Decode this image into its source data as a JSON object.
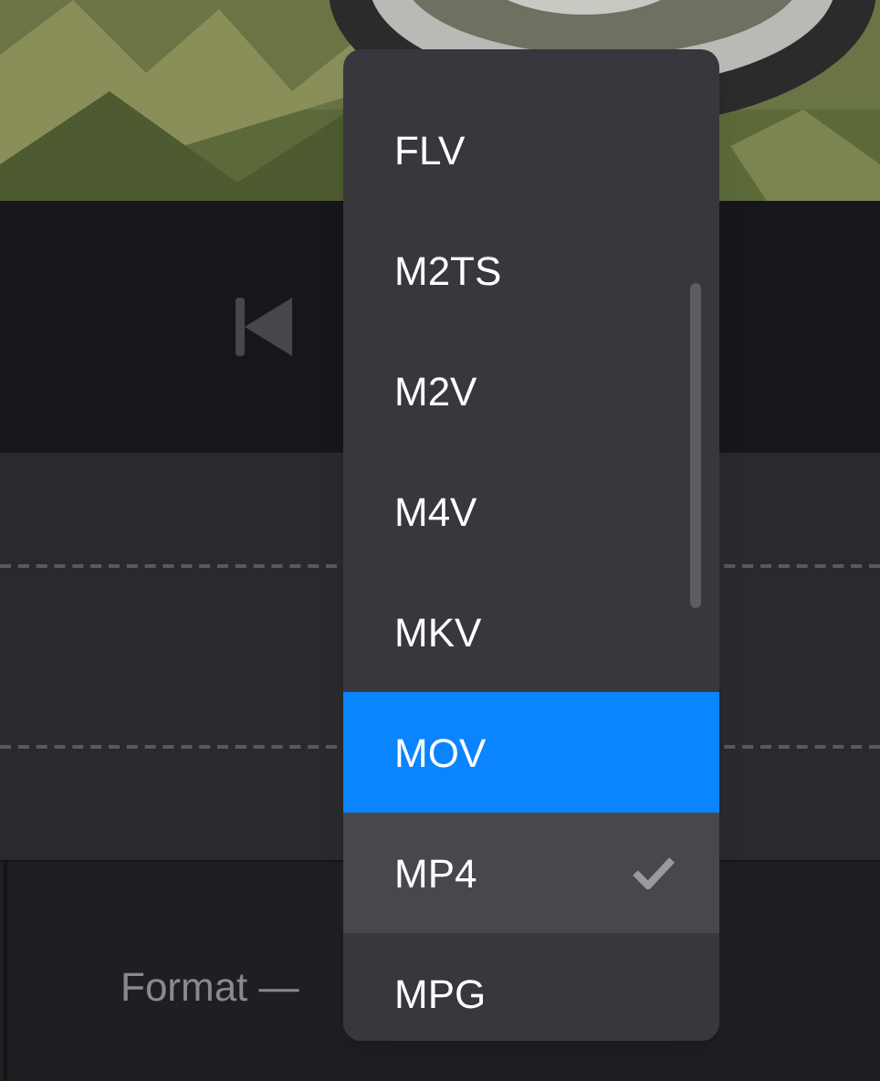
{
  "format_label": "Format —",
  "format_menu": {
    "items": [
      {
        "label": "FLV",
        "selected": false,
        "highlighted": false
      },
      {
        "label": "M2TS",
        "selected": false,
        "highlighted": false
      },
      {
        "label": "M2V",
        "selected": false,
        "highlighted": false
      },
      {
        "label": "M4V",
        "selected": false,
        "highlighted": false
      },
      {
        "label": "MKV",
        "selected": false,
        "highlighted": false
      },
      {
        "label": "MOV",
        "selected": false,
        "highlighted": true
      },
      {
        "label": "MP4",
        "selected": true,
        "highlighted": false
      },
      {
        "label": "MPG",
        "selected": false,
        "highlighted": false
      }
    ]
  }
}
